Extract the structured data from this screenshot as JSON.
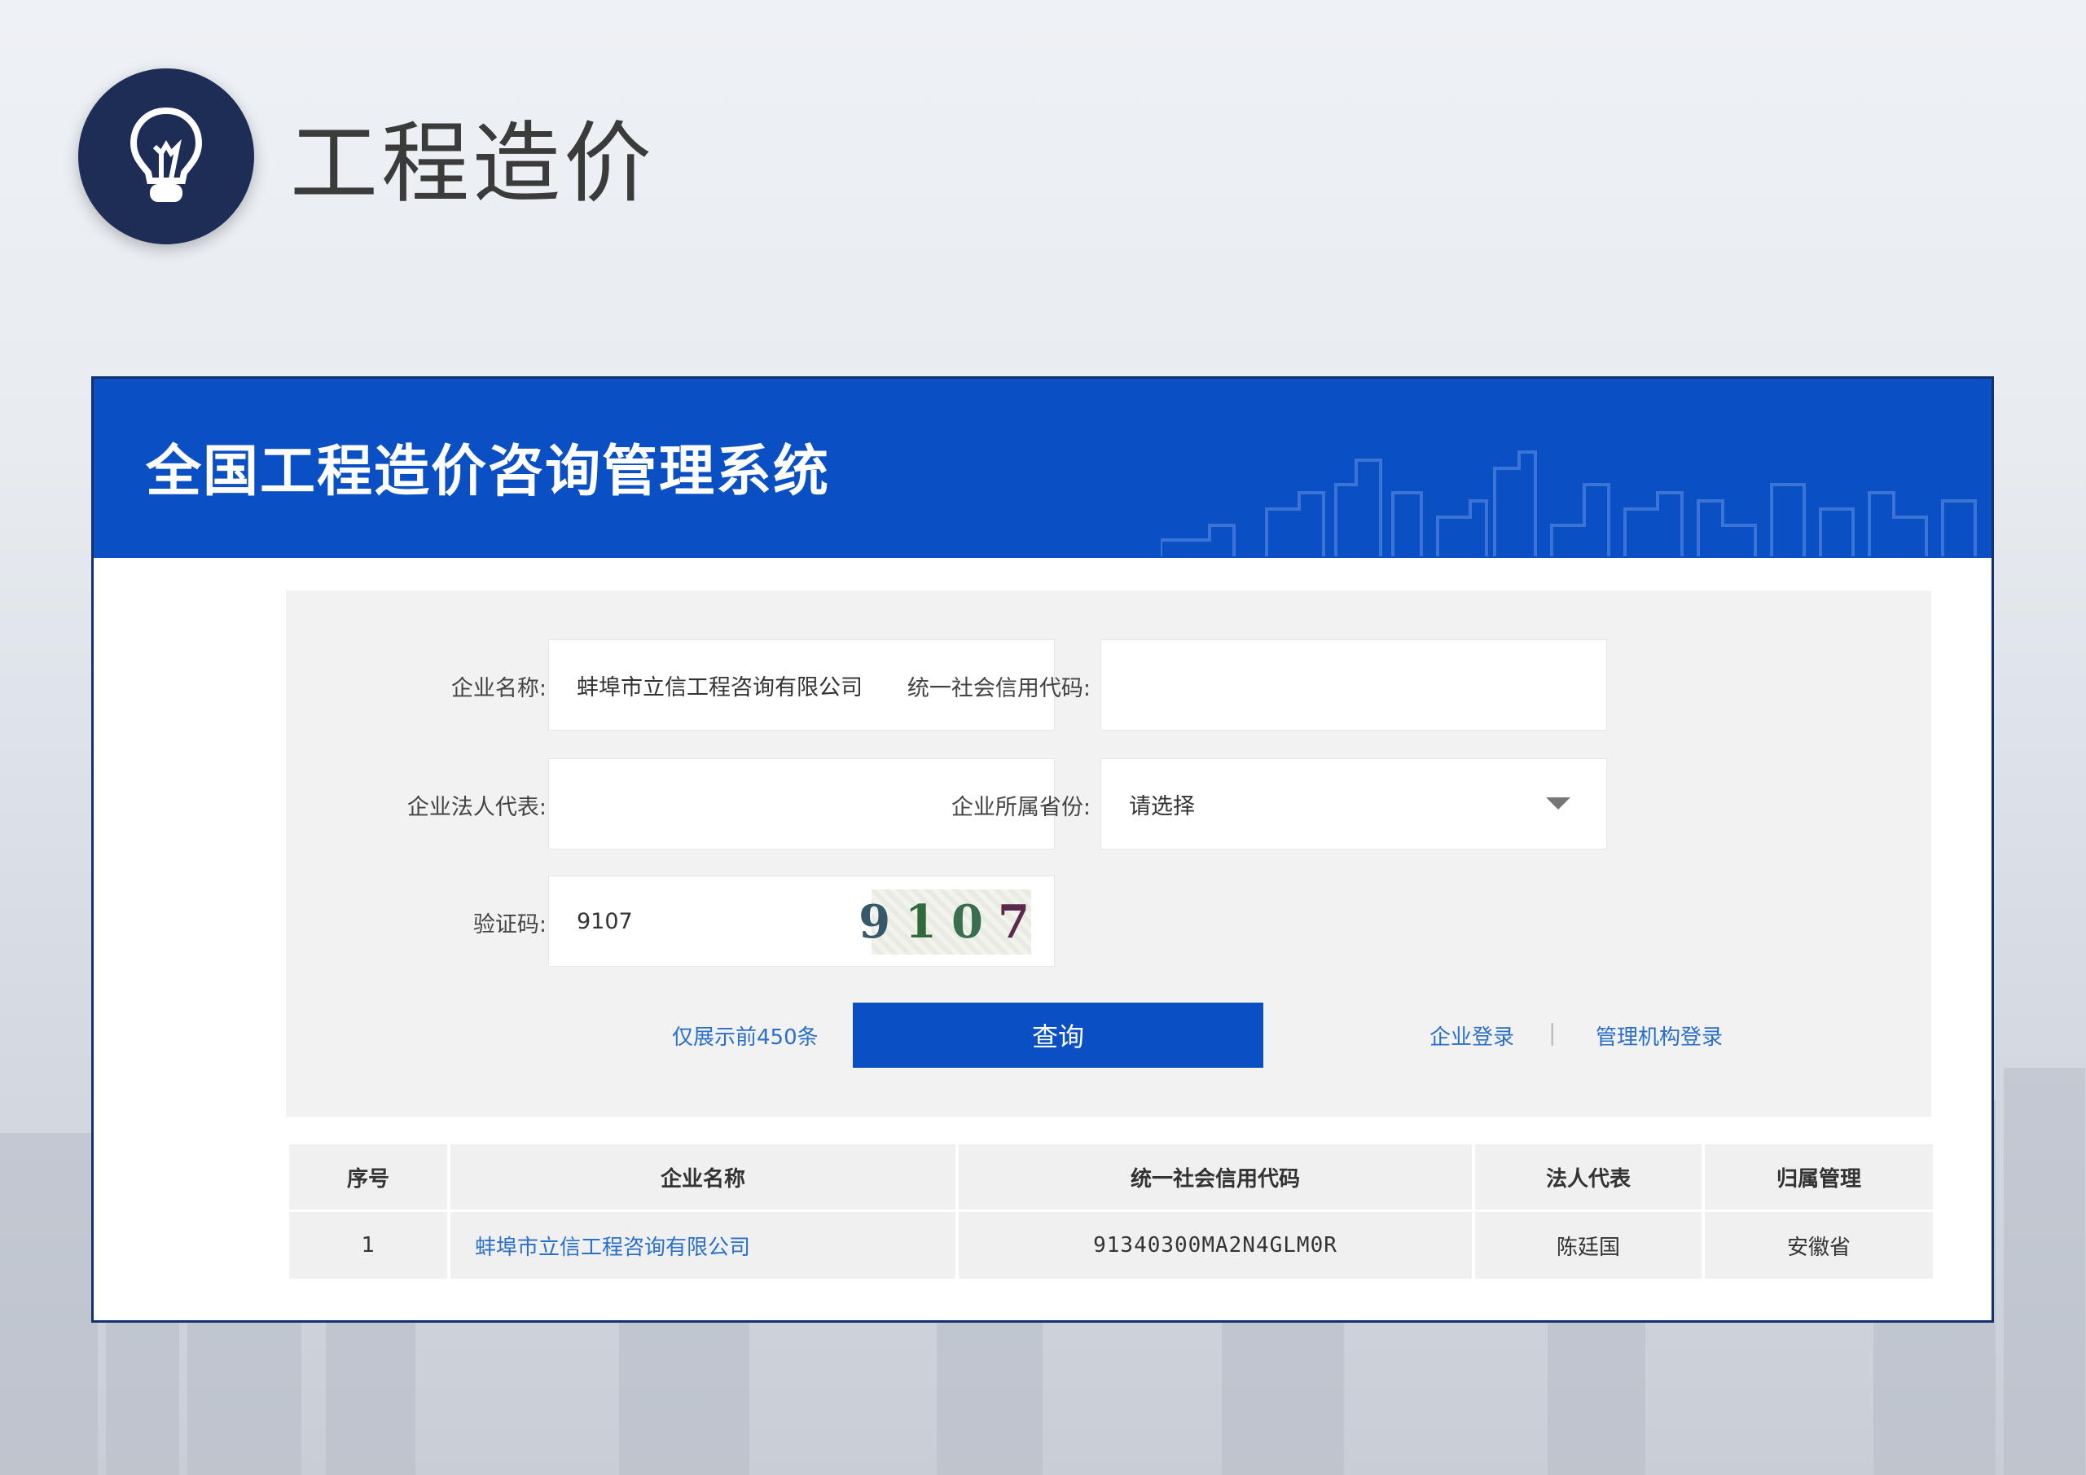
{
  "slide": {
    "title": "工程造价",
    "icon": "lightbulb-icon"
  },
  "app": {
    "title": "全国工程造价咨询管理系统"
  },
  "form": {
    "company_name": {
      "label": "企业名称:",
      "value": "蚌埠市立信工程咨询有限公司"
    },
    "credit_code": {
      "label": "统一社会信用代码:",
      "value": ""
    },
    "legal_rep": {
      "label": "企业法人代表:",
      "value": ""
    },
    "province": {
      "label": "企业所属省份:",
      "value": "请选择"
    },
    "captcha": {
      "label": "验证码:",
      "value": "9107",
      "image_text": "9107"
    }
  },
  "actions": {
    "limit_note": "仅展示前450条",
    "query_label": "查询",
    "company_login": "企业登录",
    "separator": "|",
    "admin_login": "管理机构登录"
  },
  "table": {
    "headers": [
      "序号",
      "企业名称",
      "统一社会信用代码",
      "法人代表",
      "归属管理"
    ],
    "rows": [
      [
        "1",
        "蚌埠市立信工程咨询有限公司",
        "91340300MA2N4GLM0R",
        "陈廷国",
        "安徽省"
      ]
    ]
  },
  "colors": {
    "brand_blue": "#0a4fc4",
    "badge_navy": "#1d2d56",
    "link_blue": "#2a6fc9"
  }
}
